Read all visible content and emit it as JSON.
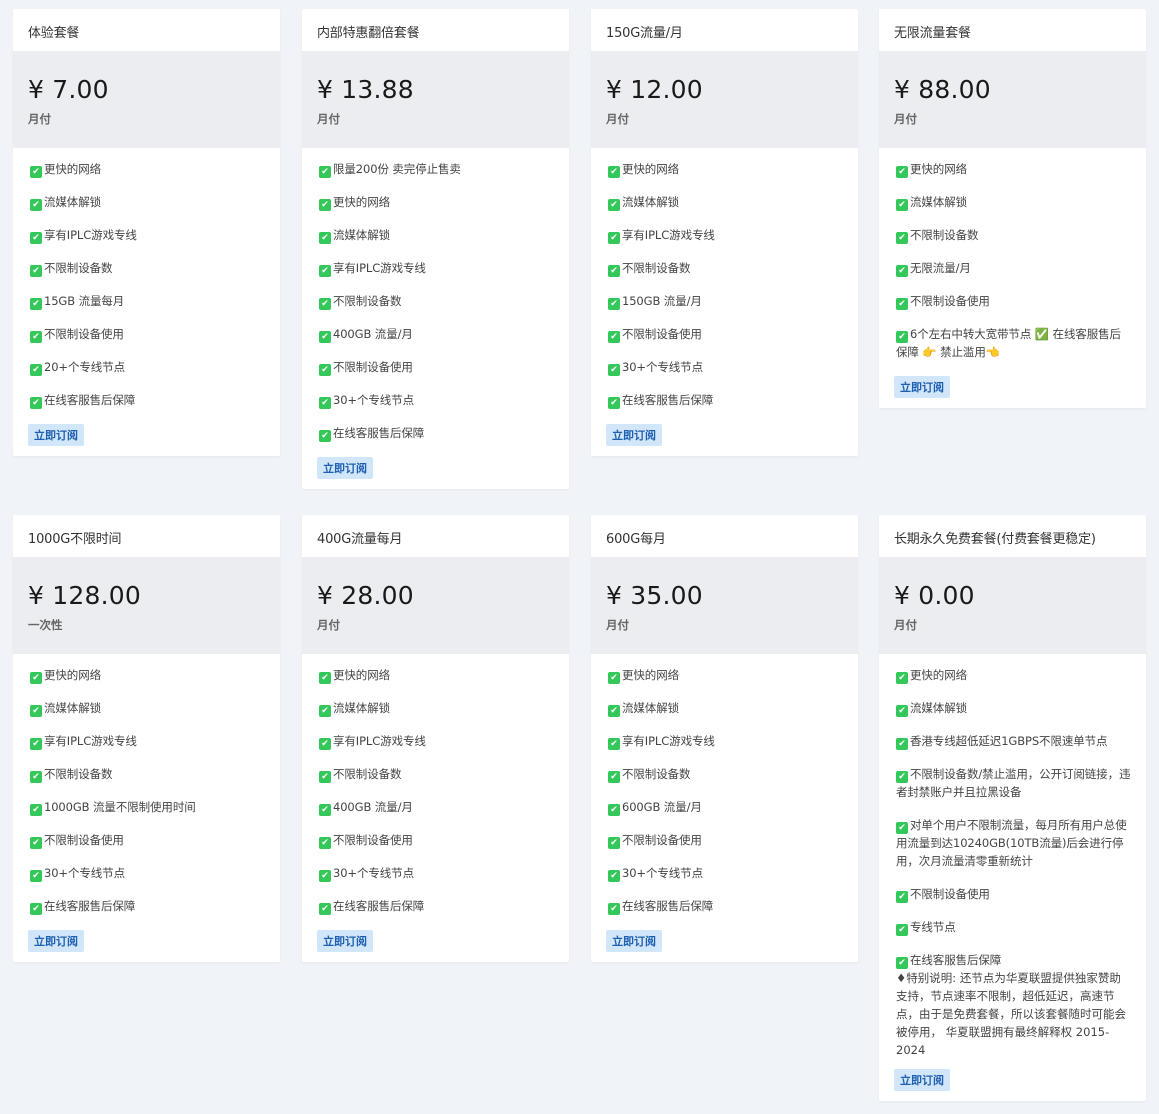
{
  "subscribe_label": "立即订阅",
  "check_icon": "✔",
  "colors": {
    "background": "#f0f3f8",
    "card": "#ffffff",
    "price_block": "#ebedf0",
    "check": "#34c759",
    "button_bg": "#d2e6fa",
    "button_text": "#1d5fb0"
  },
  "plans": [
    {
      "name": "体验套餐",
      "price": "¥ 7.00",
      "period": "月付",
      "features": [
        "更快的网络",
        "流媒体解锁",
        "享有IPLC游戏专线",
        "不限制设备数",
        "15GB 流量每月",
        "不限制设备使用",
        "20+个专线节点",
        "在线客服售后保障"
      ]
    },
    {
      "name": "内部特惠翻倍套餐",
      "price": "¥ 13.88",
      "period": "月付",
      "features": [
        "限量200份 卖完停止售卖",
        "更快的网络",
        "流媒体解锁",
        "享有IPLC游戏专线",
        "不限制设备数",
        "400GB 流量/月",
        "不限制设备使用",
        "30+个专线节点",
        "在线客服售后保障"
      ]
    },
    {
      "name": "150G流量/月",
      "price": "¥ 12.00",
      "period": "月付",
      "features": [
        "更快的网络",
        "流媒体解锁",
        "享有IPLC游戏专线",
        "不限制设备数",
        "150GB 流量/月",
        "不限制设备使用",
        "30+个专线节点",
        "在线客服售后保障"
      ]
    },
    {
      "name": "无限流量套餐",
      "price": "¥ 88.00",
      "period": "月付",
      "features": [
        "更快的网络",
        "流媒体解锁",
        "不限制设备数",
        "无限流量/月",
        "不限制设备使用",
        "6个左右中转大宽带节点 ✅ 在线客服售后保障 👉 禁止滥用👈"
      ]
    },
    {
      "name": "1000G不限时间",
      "price": "¥ 128.00",
      "period": "一次性",
      "features": [
        "更快的网络",
        "流媒体解锁",
        "享有IPLC游戏专线",
        "不限制设备数",
        "1000GB 流量不限制使用时间",
        "不限制设备使用",
        "30+个专线节点",
        "在线客服售后保障"
      ]
    },
    {
      "name": "400G流量每月",
      "price": "¥ 28.00",
      "period": "月付",
      "features": [
        "更快的网络",
        "流媒体解锁",
        "享有IPLC游戏专线",
        "不限制设备数",
        "400GB 流量/月",
        "不限制设备使用",
        "30+个专线节点",
        "在线客服售后保障"
      ]
    },
    {
      "name": "600G每月",
      "price": "¥ 35.00",
      "period": "月付",
      "features": [
        "更快的网络",
        "流媒体解锁",
        "享有IPLC游戏专线",
        "不限制设备数",
        "600GB 流量/月",
        "不限制设备使用",
        "30+个专线节点",
        "在线客服售后保障"
      ]
    },
    {
      "name": "长期永久免费套餐(付费套餐更稳定)",
      "price": "¥ 0.00",
      "period": "月付",
      "features": [
        "更快的网络",
        "流媒体解锁",
        "香港专线超低延迟1GBPS不限速单节点",
        "不限制设备数/禁止滥用，公开订阅链接，违者封禁账户并且拉黑设备",
        "对单个用户不限制流量，每月所有用户总使用流量到达10240GB(10TB流量)后会进行停用，次月流量清零重新统计",
        "不限制设备使用",
        "专线节点",
        "在线客服售后保障"
      ],
      "note": "♦特别说明: 还节点为华夏联盟提供独家赞助支持，节点速率不限制，超低延迟，高速节点，由于是免费套餐，所以该套餐随时可能会被停用，  华夏联盟拥有最终解释权 2015-2024"
    }
  ]
}
